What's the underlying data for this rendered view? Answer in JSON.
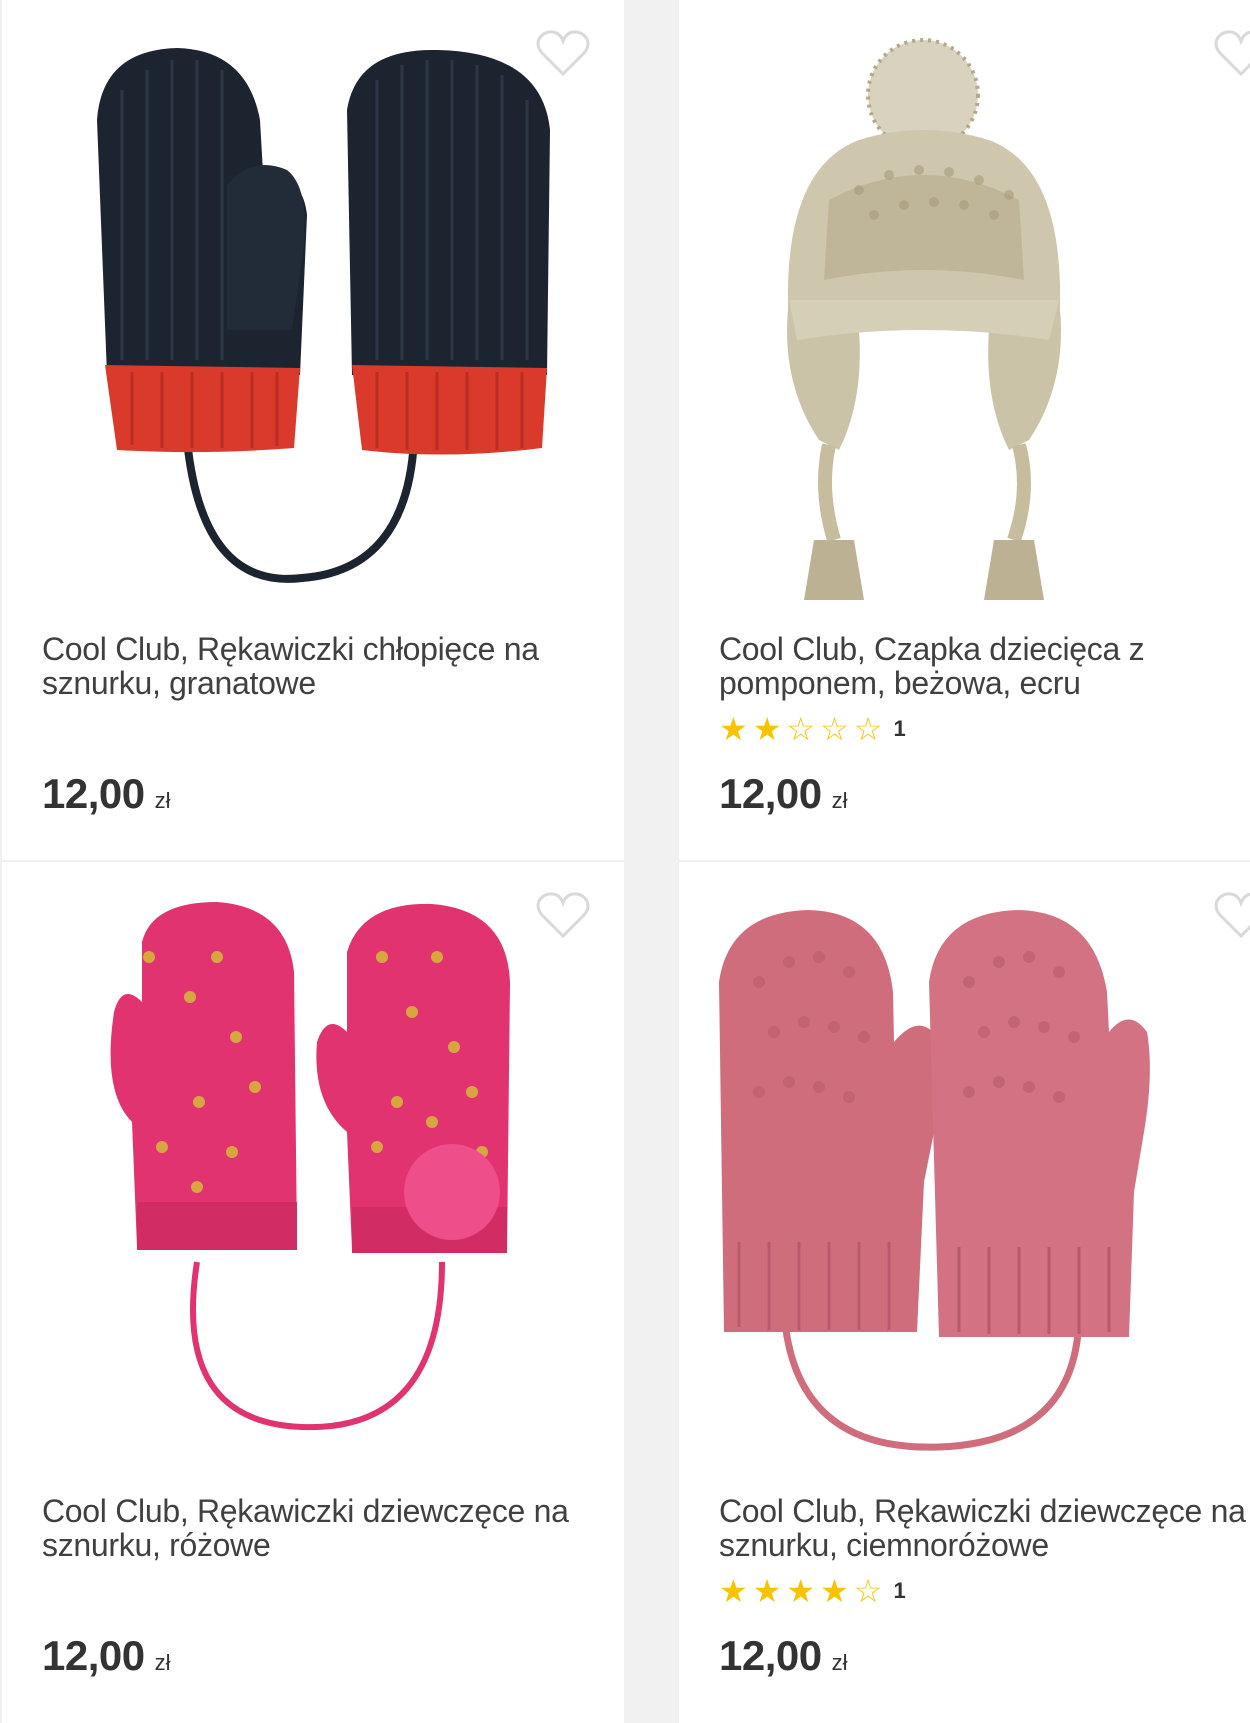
{
  "products": [
    {
      "title": "Cool Club, Rękawiczki chłopięce na sznurku, granatowe",
      "price": "12,00",
      "currency": "zł",
      "image_icon": "navy-red-mittens-image",
      "colors": {
        "main": "#1c2430",
        "cuff": "#d93a2b"
      }
    },
    {
      "title": "Cool Club, Czapka dziecięca z pomponem, beżowa, ecru",
      "price": "12,00",
      "currency": "zł",
      "rating": {
        "stars": 2,
        "max": 5,
        "count": "1"
      },
      "image_icon": "beige-pompom-hat-image",
      "colors": {
        "main": "#cfc7ad",
        "dark": "#a79c7c"
      }
    },
    {
      "title": "Cool Club, Rękawiczki dziewczęce na sznurku, różowe",
      "price": "12,00",
      "currency": "zł",
      "image_icon": "pink-polka-dot-mittens-image",
      "colors": {
        "main": "#e0336f",
        "dots": "#d7a641"
      }
    },
    {
      "title": "Cool Club, Rękawiczki dziewczęce na sznurku, ciemnoróżowe",
      "price": "12,00",
      "currency": "zł",
      "rating": {
        "stars": 4,
        "max": 5,
        "count": "1"
      },
      "image_icon": "dusty-pink-mittens-image",
      "colors": {
        "main": "#cf6d7d"
      }
    }
  ],
  "icons": {
    "favorite": "heart-outline-icon",
    "star_full": "star-full-icon",
    "star_empty": "star-outline-icon"
  },
  "accent": {
    "star": "#f8c400",
    "heart": "#d9d9d9"
  }
}
